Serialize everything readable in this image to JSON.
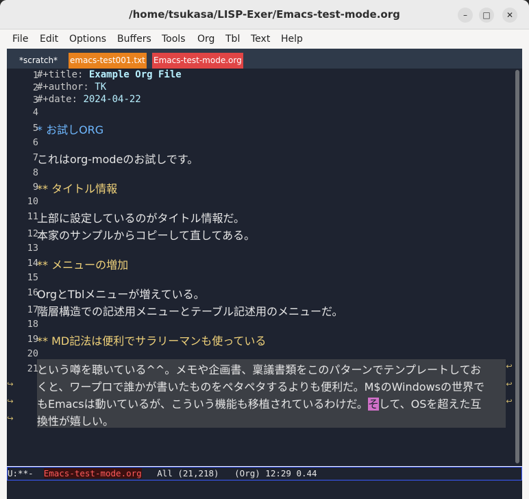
{
  "window": {
    "title": "/home/tsukasa/LISP-Exer/Emacs-test-mode.org",
    "minimize_glyph": "–",
    "maximize_glyph": "□",
    "close_glyph": "✕"
  },
  "menubar": [
    "File",
    "Edit",
    "Options",
    "Buffers",
    "Tools",
    "Org",
    "Tbl",
    "Text",
    "Help"
  ],
  "tabs": [
    {
      "label": "*scratch*",
      "bg": "#2f3a4a",
      "fg": "#ffffff"
    },
    {
      "label": "emacs-test001.txt",
      "bg": "#e8821e",
      "fg": "#ffffff"
    },
    {
      "label": "Emacs-test-mode.org",
      "bg": "#e04545",
      "fg": "#ffffff"
    }
  ],
  "buffer": {
    "line_numbers": [
      "1",
      "2",
      "3",
      "4",
      "5",
      "6",
      "7",
      "8",
      "9",
      "10",
      "11",
      "12",
      "13",
      "14",
      "15",
      "16",
      "17",
      "18",
      "19",
      "20",
      "21"
    ],
    "l1_kw": "#+title: ",
    "l1_val": "Example Org File",
    "l2_kw": "#+author:",
    "l2_val": "TK",
    "l3_kw": "#+date:  ",
    "l3_val": "2024-04-22",
    "l5": "* お試しORG",
    "l7": "これはorg-modeのお試しです。",
    "l9": "** タイトル情報",
    "l11": "上部に設定しているのがタイトル情報だ。",
    "l12": "本家のサンプルからコピーして直してある。",
    "l14": "** メニューの増加",
    "l16": "OrgとTblメニューが増えている。",
    "l17": "階層構造での記述用メニューとテーブル記述用のメニューだ。",
    "l19": "** MD記法は便利でサラリーマンも使っている",
    "l21_a": "という噂を聴いている^^。メモや企画書、稟議書類をこのパターンでテンプレートしてお",
    "l21_b": "くと、ワープロで誰かが書いたものをペタペタするよりも便利だ。M$のWindowsの世界で",
    "l21_c1": "もEmacsは動いているが、こういう機能も移植されているわけだ。",
    "l21_cursor": "そ",
    "l21_c2": "して、OSを超えた互",
    "l21_d": "換性が嬉しい。"
  },
  "modeline": {
    "status": "U:**-  ",
    "buffer_name": "Emacs-test-mode.org",
    "position": "   All (21,218)   (Org) 12:29 0.44"
  },
  "colors": {
    "editor_bg": "#1e2330",
    "tabbar_bg": "#2f3a4a",
    "cursor": "#d070c8",
    "heading1": "#6fb8ff",
    "heading2": "#f0d27a"
  }
}
